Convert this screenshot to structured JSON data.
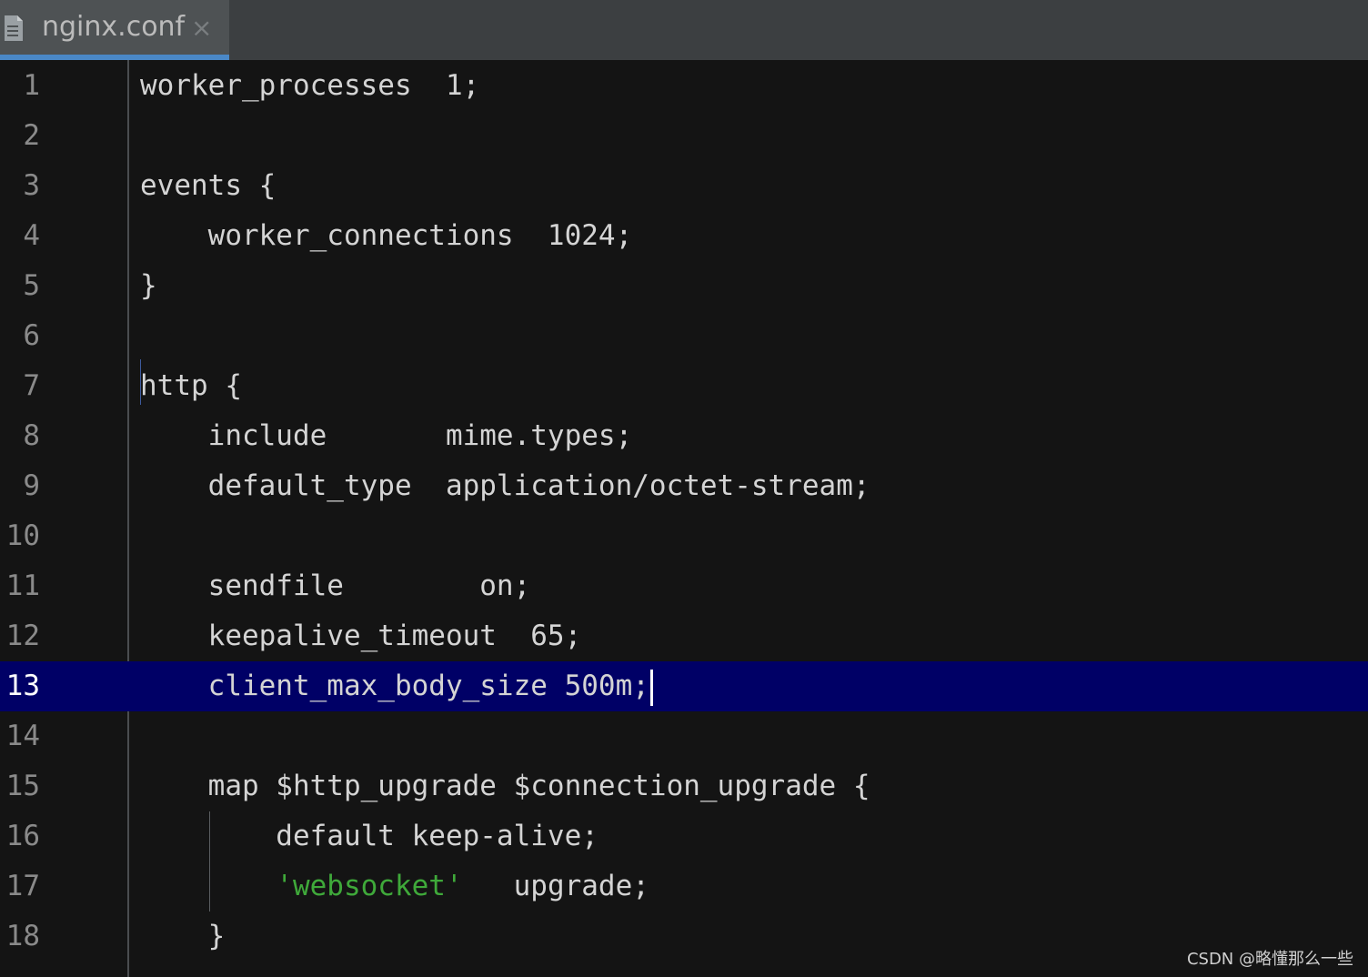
{
  "tab": {
    "title": "nginx.conf",
    "close_glyph": "×",
    "icon": "file-icon"
  },
  "editor": {
    "current_line": 13,
    "lines": [
      {
        "n": "1",
        "text": "worker_processes  1;"
      },
      {
        "n": "2",
        "text": ""
      },
      {
        "n": "3",
        "text": "events {"
      },
      {
        "n": "4",
        "text": "    worker_connections  1024;"
      },
      {
        "n": "5",
        "text": "}"
      },
      {
        "n": "6",
        "text": ""
      },
      {
        "n": "7",
        "text": "http {"
      },
      {
        "n": "8",
        "text": "    include       mime.types;"
      },
      {
        "n": "9",
        "text": "    default_type  application/octet-stream;"
      },
      {
        "n": "10",
        "text": ""
      },
      {
        "n": "11",
        "text": "    sendfile        on;"
      },
      {
        "n": "12",
        "text": "    keepalive_timeout  65;"
      },
      {
        "n": "13",
        "text": "    client_max_body_size 500m;"
      },
      {
        "n": "14",
        "text": ""
      },
      {
        "n": "15",
        "text": "    map $http_upgrade $connection_upgrade {"
      },
      {
        "n": "16",
        "text": "        default keep-alive;"
      },
      {
        "n": "17",
        "pre": "        ",
        "str": "'websocket'",
        "post": "   upgrade;"
      },
      {
        "n": "18",
        "text": "    }"
      }
    ]
  },
  "watermark": "CSDN @略懂那么一些",
  "colors": {
    "background": "#141414",
    "current_line": "#000066",
    "string": "#3fa93a",
    "tab_underline": "#4a88c7"
  }
}
